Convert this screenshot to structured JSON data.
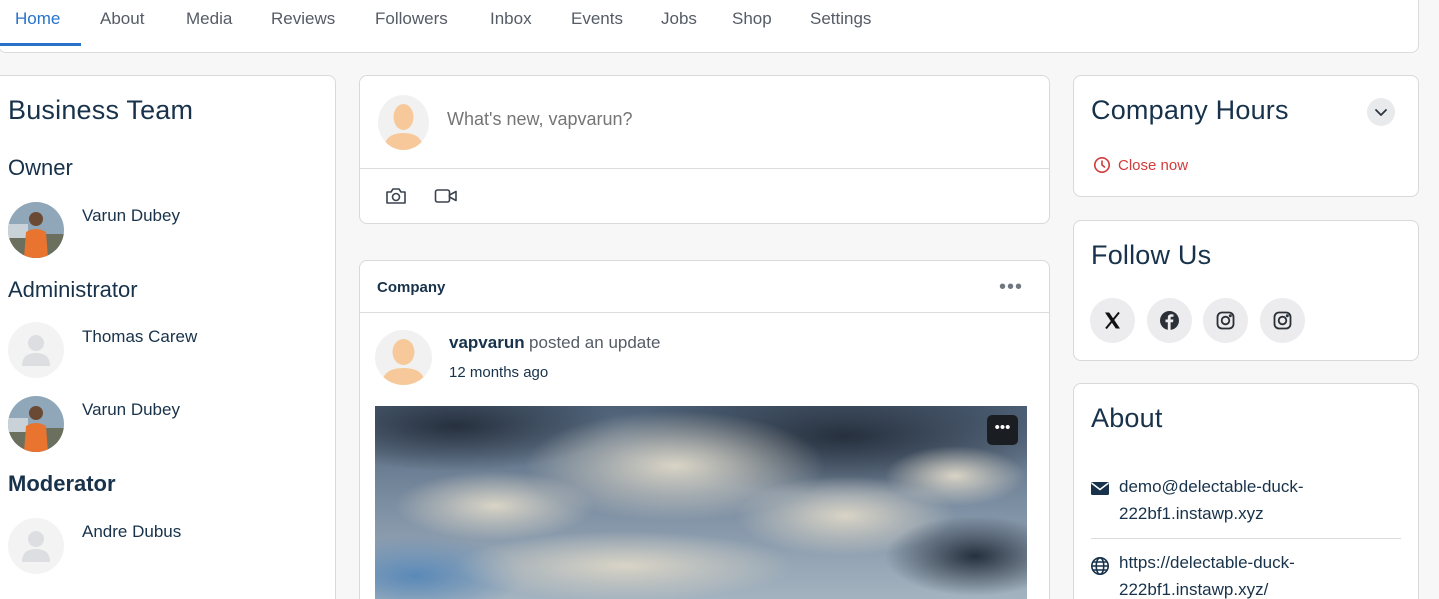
{
  "nav": {
    "items": [
      {
        "label": "Home",
        "active": true
      },
      {
        "label": "About"
      },
      {
        "label": "Media"
      },
      {
        "label": "Reviews"
      },
      {
        "label": "Followers"
      },
      {
        "label": "Inbox"
      },
      {
        "label": "Events"
      },
      {
        "label": "Jobs"
      },
      {
        "label": "Shop"
      },
      {
        "label": "Settings"
      }
    ],
    "accent": "#2872c9"
  },
  "business_team": {
    "title": "Business Team",
    "owner": {
      "label": "Owner",
      "members": [
        "Varun Dubey"
      ]
    },
    "administrator": {
      "label": "Administrator",
      "members": [
        "Thomas Carew",
        "Varun Dubey"
      ]
    },
    "moderator": {
      "label": "Moderator",
      "members": [
        "Andre Dubus"
      ]
    }
  },
  "composer": {
    "placeholder": "What's new, vapvarun?",
    "icons": [
      "camera-icon",
      "video-icon"
    ]
  },
  "post": {
    "group": "Company",
    "user": "vapvarun",
    "action": "posted an update",
    "time": "12 months ago"
  },
  "company_hours": {
    "title": "Company Hours",
    "status": "Close now",
    "status_color": "#d03b3b"
  },
  "follow_us": {
    "title": "Follow Us",
    "icons": [
      "x-icon",
      "facebook-icon",
      "instagram-icon",
      "instagram-icon"
    ]
  },
  "about": {
    "title": "About",
    "email_line1": "demo@delectable-duck-",
    "email_line2": "222bf1.instawp.xyz",
    "url_line1": "https://delectable-duck-",
    "url_line2": "222bf1.instawp.xyz/"
  }
}
